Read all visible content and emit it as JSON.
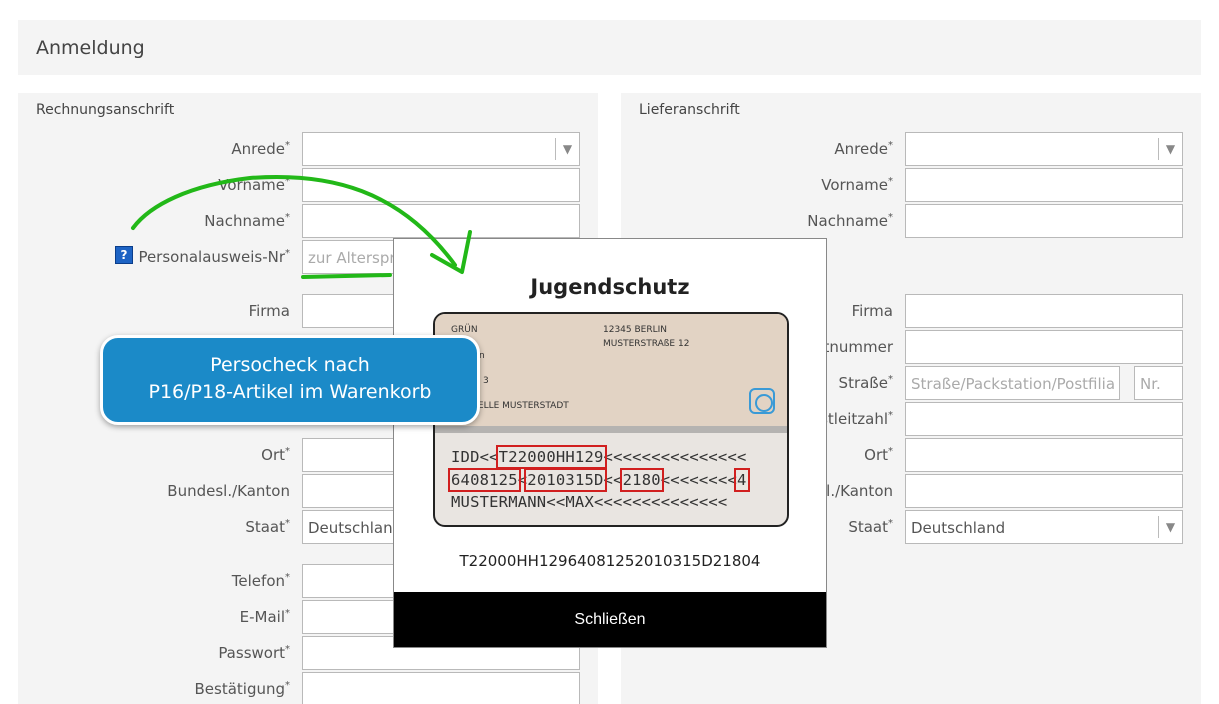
{
  "header": {
    "title": "Anmeldung"
  },
  "billing": {
    "title": "Rechnungsanschrift",
    "anrede": "Anrede",
    "vorname": "Vorname",
    "nachname": "Nachname",
    "ausweis": "Personalausweis-Nr",
    "ausweis_placeholder": "zur Alterspr",
    "firma": "Firma",
    "ort": "Ort",
    "bundesland": "Bundesl./Kanton",
    "staat": "Staat",
    "staat_value": "Deutschland",
    "telefon": "Telefon",
    "email": "E-Mail",
    "passwort": "Passwort",
    "bestaetigung": "Bestätigung"
  },
  "shipping": {
    "title": "Lieferanschrift",
    "anrede": "Anrede",
    "vorname": "Vorname",
    "nachname": "Nachname",
    "firma": "Firma",
    "hausnummer_partial": "tnummer",
    "strasse": "Straße",
    "strasse_placeholder": "Straße/Packstation/Postfilia",
    "nr_placeholder": "Nr.",
    "plz_partial": "stleitzahl",
    "ort": "Ort",
    "bundesland_partial": "l./Kanton",
    "staat": "Staat",
    "staat_value": "Deutschland"
  },
  "required_mark": "*",
  "help_icon": "?",
  "modal": {
    "title": "Jugendschutz",
    "card": {
      "line1": "GRÜN",
      "line2": "n",
      "line3": "3",
      "authority": "ESTELLE MUSTERSTADT",
      "address1": "12345 BERLIN",
      "address2": "MUSTERSTRAßE 12",
      "mrz1_a": "IDD<<",
      "mrz1_b": "T22000HH129",
      "mrz1_c": "<<<<<<<<<<<<<<<",
      "mrz2_a": "6408125",
      "mrz2_b": "<",
      "mrz2_c": "2010315D",
      "mrz2_d": "<<",
      "mrz2_e": "2180",
      "mrz2_f": "<<<<<<<<",
      "mrz2_g": "4",
      "mrz3": "MUSTERMANN<<MAX<<<<<<<<<<<<<<"
    },
    "result": "T22000HH12964081252010315D21804",
    "close_label": "Schließen"
  },
  "callout": {
    "line1": "Persocheck nach",
    "line2": "P16/P18-Artikel im Warenkorb"
  },
  "colors": {
    "accent_callout": "#1b8ac8",
    "arrow": "#22b818",
    "highlight": "#d11f1f",
    "help": "#1d63c4"
  }
}
